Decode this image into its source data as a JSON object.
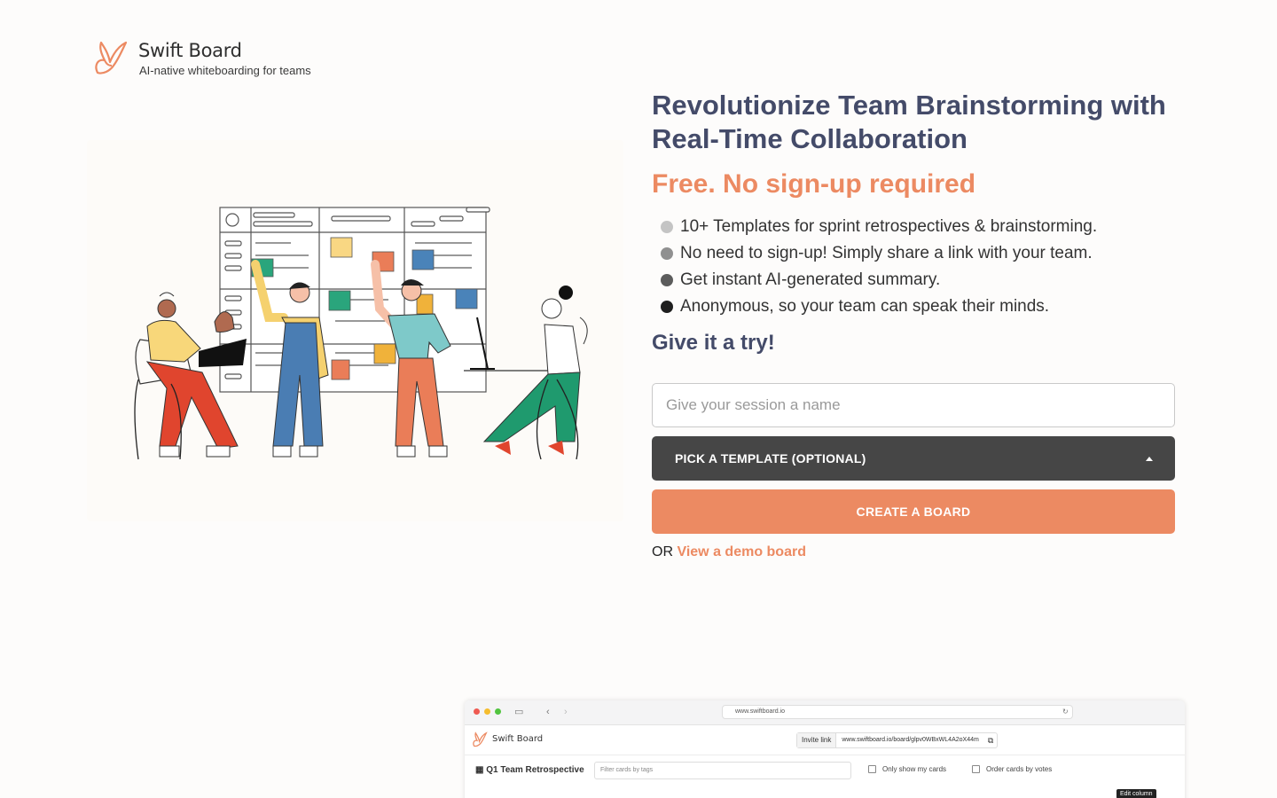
{
  "brand": {
    "name": "Swift Board",
    "tagline": "AI-native whiteboarding for teams"
  },
  "hero": {
    "headline": "Revolutionize Team Brainstorming with Real-Time Collaboration",
    "subhead": "Free. No sign-up required",
    "features": [
      {
        "text": "10+ Templates for sprint retrospectives & brainstorming.",
        "color": "#c4c4c4"
      },
      {
        "text": "No need to sign-up! Simply share a link with your team.",
        "color": "#909090"
      },
      {
        "text": "Get instant AI-generated summary.",
        "color": "#5c5c5c"
      },
      {
        "text": "Anonymous, so your team can speak their minds.",
        "color": "#1f1f1f"
      }
    ],
    "cta_title": "Give it a try!"
  },
  "form": {
    "session_placeholder": "Give your session a name",
    "template_label": "PICK A TEMPLATE (OPTIONAL)",
    "create_label": "CREATE A BOARD",
    "or_text": "OR",
    "demo_link": "View a demo board"
  },
  "preview": {
    "url": "www.swiftboard.io",
    "brand": "Swift Board",
    "invite_label": "Invite link",
    "invite_url": "www.swiftboard.io/board/glpv0WBxWL4A2oX44m",
    "board_title": "Q1 Team Retrospective",
    "filter_placeholder": "Filter cards by tags",
    "check_mine": "Only show my cards",
    "check_votes": "Order cards by votes",
    "edit_column": "Edit column"
  },
  "colors": {
    "accent": "#ec8a62",
    "heading": "#444b69",
    "dark_button": "#464646"
  },
  "icons": [
    "swift-bird-logo-icon",
    "caret-up-icon",
    "browser-sidebar-icon",
    "back-icon",
    "forward-icon",
    "refresh-icon",
    "copy-icon",
    "board-icon"
  ]
}
